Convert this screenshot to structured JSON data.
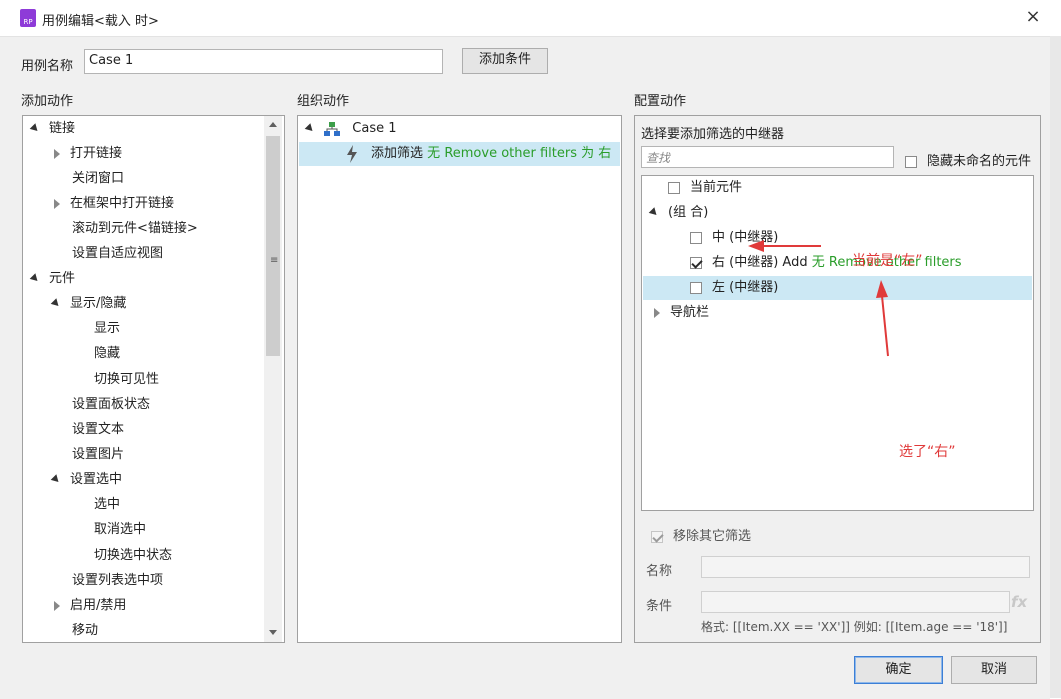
{
  "window": {
    "title": "用例编辑<载入 时>",
    "app_icon": "RP",
    "close": "×"
  },
  "case_name": {
    "label": "用例名称",
    "value": "Case 1",
    "add_condition_button": "添加条件"
  },
  "left": {
    "header": "添加动作",
    "items": [
      {
        "label": "链接"
      },
      {
        "label": "打开链接"
      },
      {
        "label": "关闭窗口"
      },
      {
        "label": "在框架中打开链接"
      },
      {
        "label": "滚动到元件<锚链接>"
      },
      {
        "label": "设置自适应视图"
      },
      {
        "label": "元件"
      },
      {
        "label": "显示/隐藏"
      },
      {
        "label": "显示"
      },
      {
        "label": "隐藏"
      },
      {
        "label": "切换可见性"
      },
      {
        "label": "设置面板状态"
      },
      {
        "label": "设置文本"
      },
      {
        "label": "设置图片"
      },
      {
        "label": "设置选中"
      },
      {
        "label": "选中"
      },
      {
        "label": "取消选中"
      },
      {
        "label": "切换选中状态"
      },
      {
        "label": "设置列表选中项"
      },
      {
        "label": "启用/禁用"
      },
      {
        "label": "移动"
      }
    ]
  },
  "middle": {
    "header": "组织动作",
    "case_label": "Case 1",
    "action": {
      "name": "添加筛选",
      "none": "无",
      "detail": "Remove other filters",
      "for": "为",
      "target": "右"
    }
  },
  "right": {
    "header": "配置动作",
    "sub_header": "选择要添加筛选的中继器",
    "search_placeholder": "查找",
    "hide_unnamed_label": "隐藏未命名的元件",
    "tree": {
      "current": "当前元件",
      "group": "(组 合)",
      "mid": "中 (中继器)",
      "right_item": "右 (中继器) Add",
      "right_none": "无",
      "right_detail": "Remove other filters",
      "left_item": "左 (中继器)",
      "nav": "导航栏"
    },
    "remove_others_label": "移除其它筛选",
    "name_label": "名称",
    "condition_label": "条件",
    "fx": "fx",
    "format_hint": "格式: [[Item.XX == 'XX']] 例如: [[Item.age == '18']]"
  },
  "annotations": {
    "current_is_left": "当前是“左”",
    "selected_right": "选了“右”"
  },
  "buttons": {
    "ok": "确定",
    "cancel": "取消"
  },
  "colors": {
    "accent": "#3c7fd6",
    "highlight": "#cce8f4",
    "annotation_red": "#e03a3a",
    "green_text": "#2a9d2a"
  }
}
